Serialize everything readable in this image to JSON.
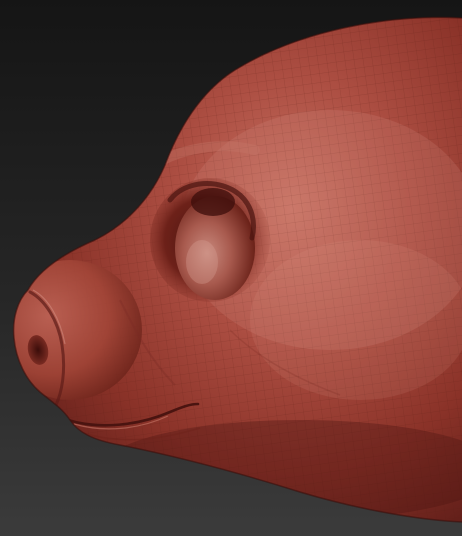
{
  "scene": {
    "subject": "sculpted-head-side-profile",
    "material": "red-wax-matcap",
    "colors": {
      "background_top": "#1b1b1b",
      "background_bottom": "#3a3a3a",
      "clay_dark": "#5e1d18",
      "clay_mid": "#9a3d33",
      "clay_light": "#c46a5c",
      "clay_highlight": "#d9958a",
      "wire": "#7a2c24"
    }
  }
}
